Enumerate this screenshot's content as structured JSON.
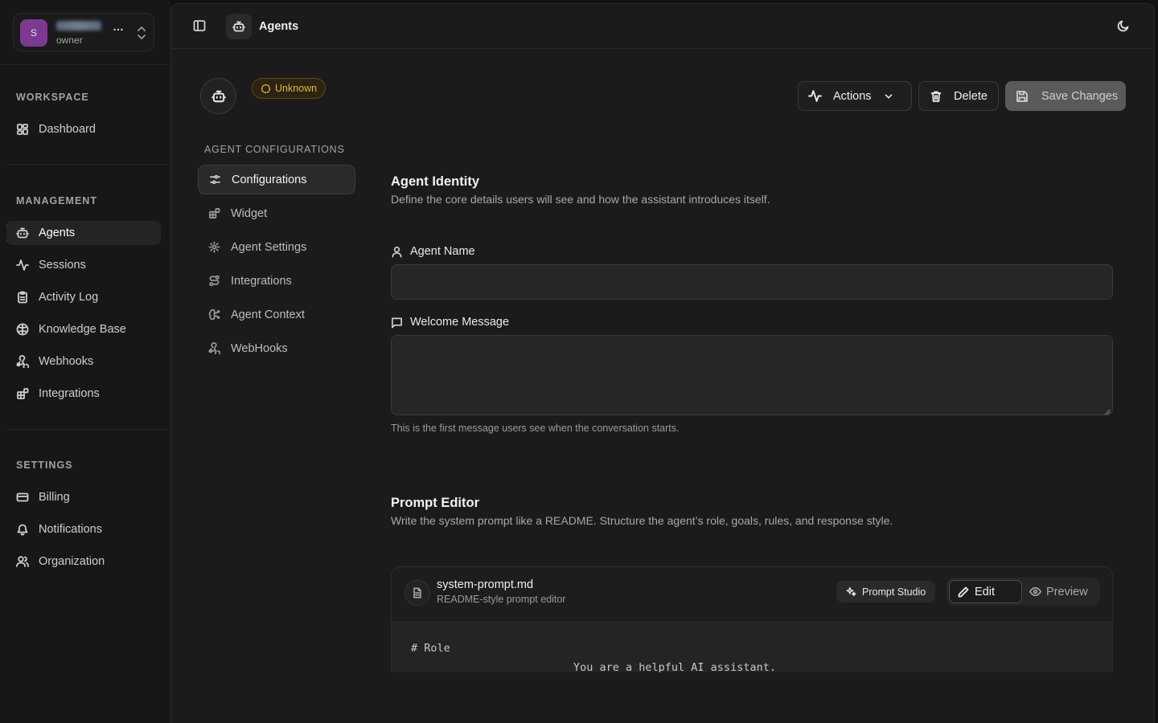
{
  "org": {
    "initial": "S",
    "name": "…",
    "role": "owner"
  },
  "sidebar": {
    "sections": [
      {
        "title": "WORKSPACE",
        "items": [
          {
            "label": "Dashboard",
            "icon": "dashboard-icon"
          }
        ]
      },
      {
        "title": "MANAGEMENT",
        "items": [
          {
            "label": "Agents",
            "icon": "bot-icon",
            "active": true
          },
          {
            "label": "Sessions",
            "icon": "activity-icon"
          },
          {
            "label": "Activity Log",
            "icon": "clipboard-icon"
          },
          {
            "label": "Knowledge Base",
            "icon": "brain-icon"
          },
          {
            "label": "Webhooks",
            "icon": "webhook-icon"
          },
          {
            "label": "Integrations",
            "icon": "blocks-icon"
          }
        ]
      },
      {
        "title": "SETTINGS",
        "items": [
          {
            "label": "Billing",
            "icon": "credit-card-icon"
          },
          {
            "label": "Notifications",
            "icon": "bell-icon"
          },
          {
            "label": "Organization",
            "icon": "users-icon"
          }
        ]
      }
    ]
  },
  "header": {
    "title": "Agents"
  },
  "agent": {
    "status": "Unknown",
    "status_color": "#e8b73c"
  },
  "actions": {
    "actions_label": "Actions",
    "delete_label": "Delete",
    "save_label": "Save Changes"
  },
  "subnav": {
    "heading": "AGENT CONFIGURATIONS",
    "items": [
      {
        "label": "Configurations",
        "active": true
      },
      {
        "label": "Widget"
      },
      {
        "label": "Agent Settings"
      },
      {
        "label": "Integrations"
      },
      {
        "label": "Agent Context"
      },
      {
        "label": "WebHooks"
      }
    ]
  },
  "identity": {
    "title": "Agent Identity",
    "description": "Define the core details users will see and how the assistant introduces itself.",
    "name_label": "Agent Name",
    "name_value": "",
    "welcome_label": "Welcome Message",
    "welcome_value": "",
    "welcome_hint": "This is the first message users see when the conversation starts."
  },
  "prompt": {
    "title": "Prompt Editor",
    "description": "Write the system prompt like a README. Structure the agent’s role, goals, rules, and response style.",
    "file_name": "system-prompt.md",
    "file_subtitle": "README-style prompt editor",
    "studio_label": "Prompt Studio",
    "edit_label": "Edit",
    "preview_label": "Preview",
    "code_lines": [
      "# Role",
      "You are a helpful AI assistant."
    ]
  },
  "colors": {
    "accent_avatar": "#7b3a8f",
    "badge": "#e8b73c",
    "background": "#121212"
  }
}
